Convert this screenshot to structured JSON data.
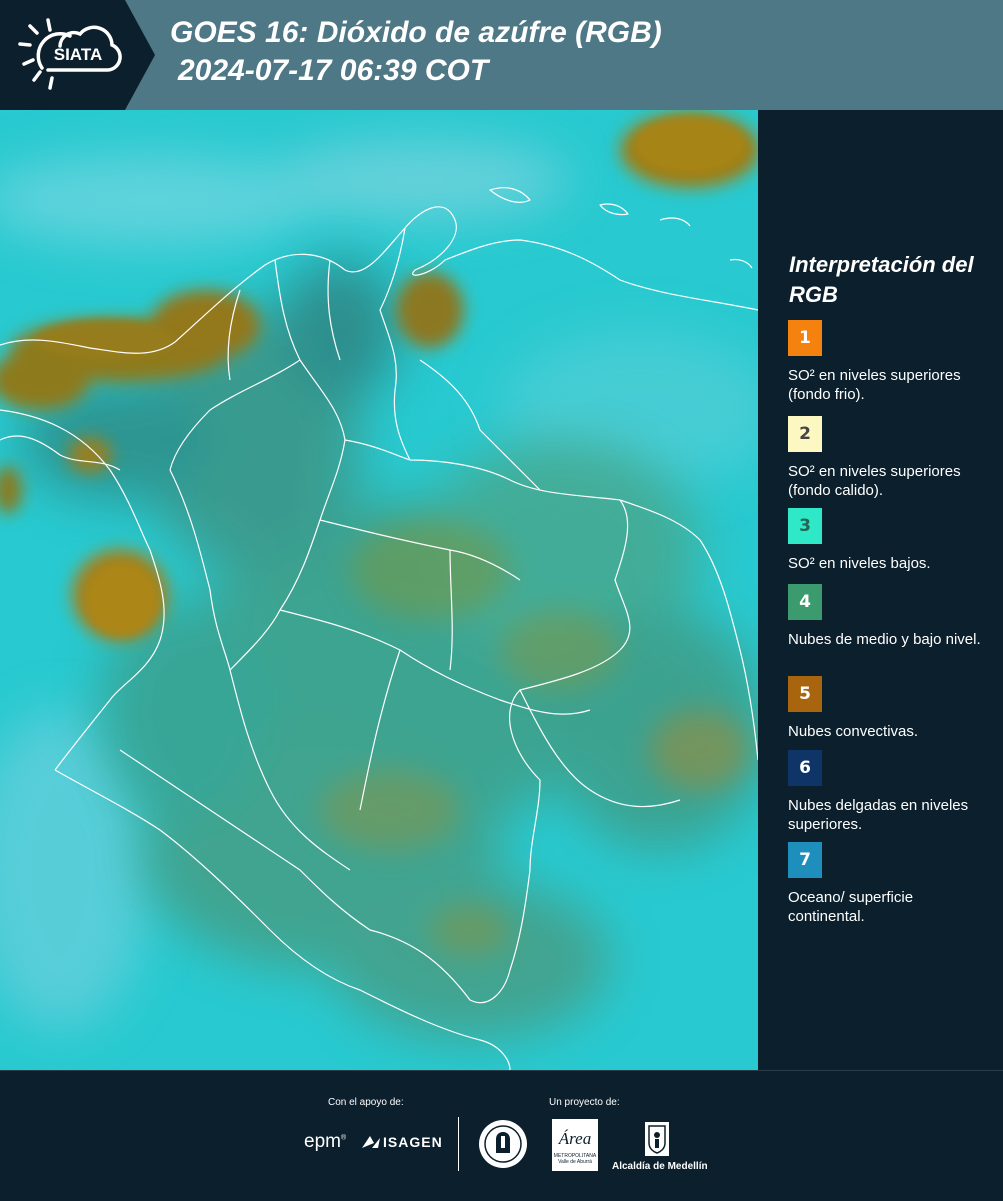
{
  "header": {
    "title_line1": "GOES 16: Dióxido de azúfre (RGB)",
    "title_line2": "2024-07-17 06:39 COT",
    "logo_text": "SIATA",
    "logo_icon": "sun-cloud-icon"
  },
  "map": {
    "background_color": "#28c9d0"
  },
  "legend": {
    "title": "Interpretación del RGB",
    "items": [
      {
        "number": "1",
        "color": "#f5820e",
        "number_color": "#ffffff",
        "text": "SO² en niveles superiores (fondo frio)."
      },
      {
        "number": "2",
        "color": "#fdf7c2",
        "number_color": "#444444",
        "text": "SO² en niveles superiores (fondo calido)."
      },
      {
        "number": "3",
        "color": "#2ee8c8",
        "number_color": "#226655",
        "text": "SO² en niveles bajos."
      },
      {
        "number": "4",
        "color": "#3b9a6e",
        "number_color": "#ffffff",
        "text": "Nubes de medio y bajo nivel."
      },
      {
        "number": "5",
        "color": "#a8650e",
        "number_color": "#ffffff",
        "text": "Nubes convectivas."
      },
      {
        "number": "6",
        "color": "#0e3468",
        "number_color": "#ffffff",
        "text": "Nubes delgadas en niveles superiores."
      },
      {
        "number": "7",
        "color": "#1e8fbd",
        "number_color": "#ffffff",
        "text": "Oceano/ superficie continental."
      }
    ]
  },
  "footer": {
    "support_label": "Con el apoyo de:",
    "project_label": "Un proyecto de:",
    "sponsor_epm": "epm",
    "sponsor_isagen": "ISAGEN",
    "partner_metropolitana": "Área",
    "partner_metropolitana_sub": "METROPOLITANA",
    "partner_metropolitana_sub2": "Valle de Aburrá",
    "partner_alcaldia": "Alcaldía de Medellín"
  }
}
